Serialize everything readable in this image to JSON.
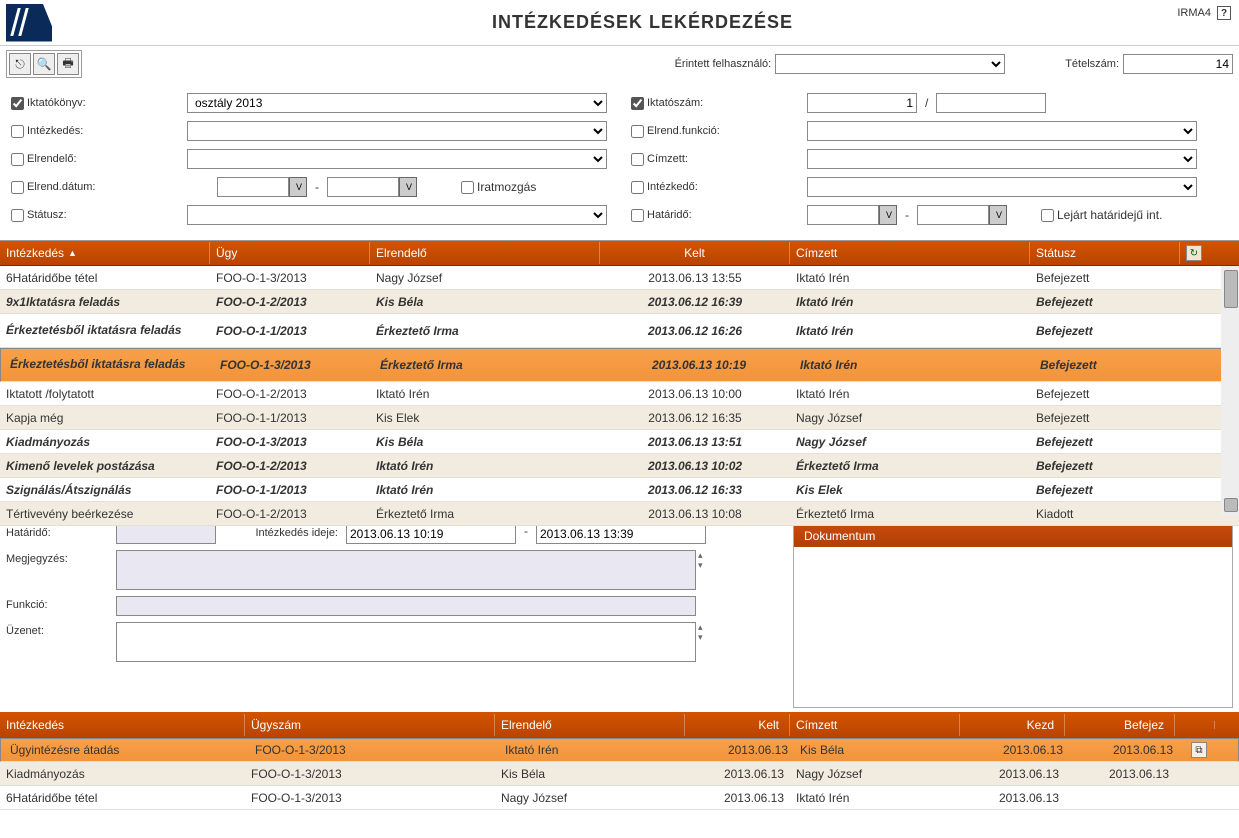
{
  "app": {
    "version": "IRMA4"
  },
  "header": {
    "title": "INTÉZKEDÉSEK LEKÉRDEZÉSE"
  },
  "toolbar": {
    "erintett_label": "Érintett felhasználó:",
    "erintett_value": "",
    "tetelszam_label": "Tételszám:",
    "tetelszam_value": "14"
  },
  "filters": {
    "iktatokonyv": {
      "label": "Iktatókönyv:",
      "checked": true,
      "value": "osztály 2013"
    },
    "iktatoszam": {
      "label": "Iktatószám:",
      "checked": true,
      "value1": "1",
      "sep": "/",
      "value2": ""
    },
    "intezkedes": {
      "label": "Intézkedés:",
      "checked": false,
      "value": ""
    },
    "elrend_funkcio": {
      "label": "Elrend.funkció:",
      "checked": false,
      "value": ""
    },
    "elrendelo": {
      "label": "Elrendelő:",
      "checked": false,
      "value": ""
    },
    "cimzett": {
      "label": "Címzett:",
      "checked": false,
      "value": ""
    },
    "elrend_datum": {
      "label": "Elrend.dátum:",
      "checked": false,
      "from": "",
      "to": ""
    },
    "iratmozgas": {
      "label": "Iratmozgás",
      "checked": false
    },
    "intezkedo": {
      "label": "Intézkedő:",
      "checked": false,
      "value": ""
    },
    "statusz": {
      "label": "Státusz:",
      "checked": false,
      "value": ""
    },
    "hatarido": {
      "label": "Határidő:",
      "checked": false,
      "from": "",
      "to": ""
    },
    "lejart": {
      "label": "Lejárt határidejű int.",
      "checked": false
    }
  },
  "main_table": {
    "columns": [
      "Intézkedés",
      "Ügy",
      "Elrendelő",
      "Kelt",
      "Címzett",
      "Státusz"
    ],
    "rows": [
      {
        "intezkedes": "6Határidőbe tétel",
        "ugy": "FOO-O-1-3/2013",
        "elrendelo": "Nagy József",
        "kelt": "2013.06.13 13:55",
        "cimzett": "Iktató Irén",
        "statusz": "Befejezett",
        "bi": false,
        "alt": false
      },
      {
        "intezkedes": "9x1Iktatásra feladás",
        "ugy": "FOO-O-1-2/2013",
        "elrendelo": "Kis Béla",
        "kelt": "2013.06.12 16:39",
        "cimzett": "Iktató Irén",
        "statusz": "Befejezett",
        "bi": true,
        "alt": true
      },
      {
        "intezkedes": "Érkeztetésből iktatásra feladás",
        "ugy": "FOO-O-1-1/2013",
        "elrendelo": "Érkeztető Irma",
        "kelt": "2013.06.12 16:26",
        "cimzett": "Iktató Irén",
        "statusz": "Befejezett",
        "bi": true,
        "alt": false,
        "tall": true
      },
      {
        "intezkedes": "Érkeztetésből iktatásra feladás",
        "ugy": "FOO-O-1-3/2013",
        "elrendelo": "Érkeztető Irma",
        "kelt": "2013.06.13 10:19",
        "cimzett": "Iktató Irén",
        "statusz": "Befejezett",
        "bi": true,
        "alt": true,
        "selected": true,
        "tall": true
      },
      {
        "intezkedes": "Iktatott /folytatott",
        "ugy": "FOO-O-1-2/2013",
        "elrendelo": "Iktató Irén",
        "kelt": "2013.06.13 10:00",
        "cimzett": "Iktató Irén",
        "statusz": "Befejezett",
        "bi": false,
        "alt": false
      },
      {
        "intezkedes": "Kapja még",
        "ugy": "FOO-O-1-1/2013",
        "elrendelo": "Kis Elek",
        "kelt": "2013.06.12 16:35",
        "cimzett": "Nagy József",
        "statusz": "Befejezett",
        "bi": false,
        "alt": true
      },
      {
        "intezkedes": "Kiadmányozás",
        "ugy": "FOO-O-1-3/2013",
        "elrendelo": "Kis Béla",
        "kelt": "2013.06.13 13:51",
        "cimzett": "Nagy József",
        "statusz": "Befejezett",
        "bi": true,
        "alt": false
      },
      {
        "intezkedes": "Kimenő levelek postázása",
        "ugy": "FOO-O-1-2/2013",
        "elrendelo": "Iktató Irén",
        "kelt": "2013.06.13 10:02",
        "cimzett": "Érkeztető Irma",
        "statusz": "Befejezett",
        "bi": true,
        "alt": true
      },
      {
        "intezkedes": "Szignálás/Átszignálás",
        "ugy": "FOO-O-1-1/2013",
        "elrendelo": "Iktató Irén",
        "kelt": "2013.06.12 16:33",
        "cimzett": "Kis Elek",
        "statusz": "Befejezett",
        "bi": true,
        "alt": false
      },
      {
        "intezkedes": "Tértivevény beérkezése",
        "ugy": "FOO-O-1-2/2013",
        "elrendelo": "Érkeztető Irma",
        "kelt": "2013.06.13 10:08",
        "cimzett": "Érkeztető Irma",
        "statusz": "Kiadott",
        "bi": false,
        "alt": true
      }
    ]
  },
  "detail": {
    "hatarido_label": "Határidő:",
    "hatarido_value": "",
    "intezkedes_ideje_label": "Intézkedés ideje:",
    "intezkedes_ideje_from": "2013.06.13 10:19",
    "intezkedes_ideje_sep": "-",
    "intezkedes_ideje_to": "2013.06.13 13:39",
    "megjegyzes_label": "Megjegyzés:",
    "megjegyzes_value": "",
    "funkcio_label": "Funkció:",
    "funkcio_value": "",
    "uzenet_label": "Üzenet:",
    "uzenet_value": "",
    "dokumentum_label": "Dokumentum"
  },
  "sub_table": {
    "columns": [
      "Intézkedés",
      "Ügyszám",
      "Elrendelő",
      "Kelt",
      "Címzett",
      "Kezd",
      "Befejez"
    ],
    "rows": [
      {
        "intezkedes": "Ügyintézésre átadás",
        "ugyszam": "FOO-O-1-3/2013",
        "elrendelo": "Iktató Irén",
        "kelt": "2013.06.13",
        "cimzett": "Kis Béla",
        "kezd": "2013.06.13",
        "befejez": "2013.06.13",
        "selected": true,
        "expand": true
      },
      {
        "intezkedes": "Kiadmányozás",
        "ugyszam": "FOO-O-1-3/2013",
        "elrendelo": "Kis Béla",
        "kelt": "2013.06.13",
        "cimzett": "Nagy József",
        "kezd": "2013.06.13",
        "befejez": "2013.06.13"
      },
      {
        "intezkedes": "6Határidőbe tétel",
        "ugyszam": "FOO-O-1-3/2013",
        "elrendelo": "Nagy József",
        "kelt": "2013.06.13",
        "cimzett": "Iktató Irén",
        "kezd": "2013.06.13",
        "befejez": ""
      }
    ]
  }
}
